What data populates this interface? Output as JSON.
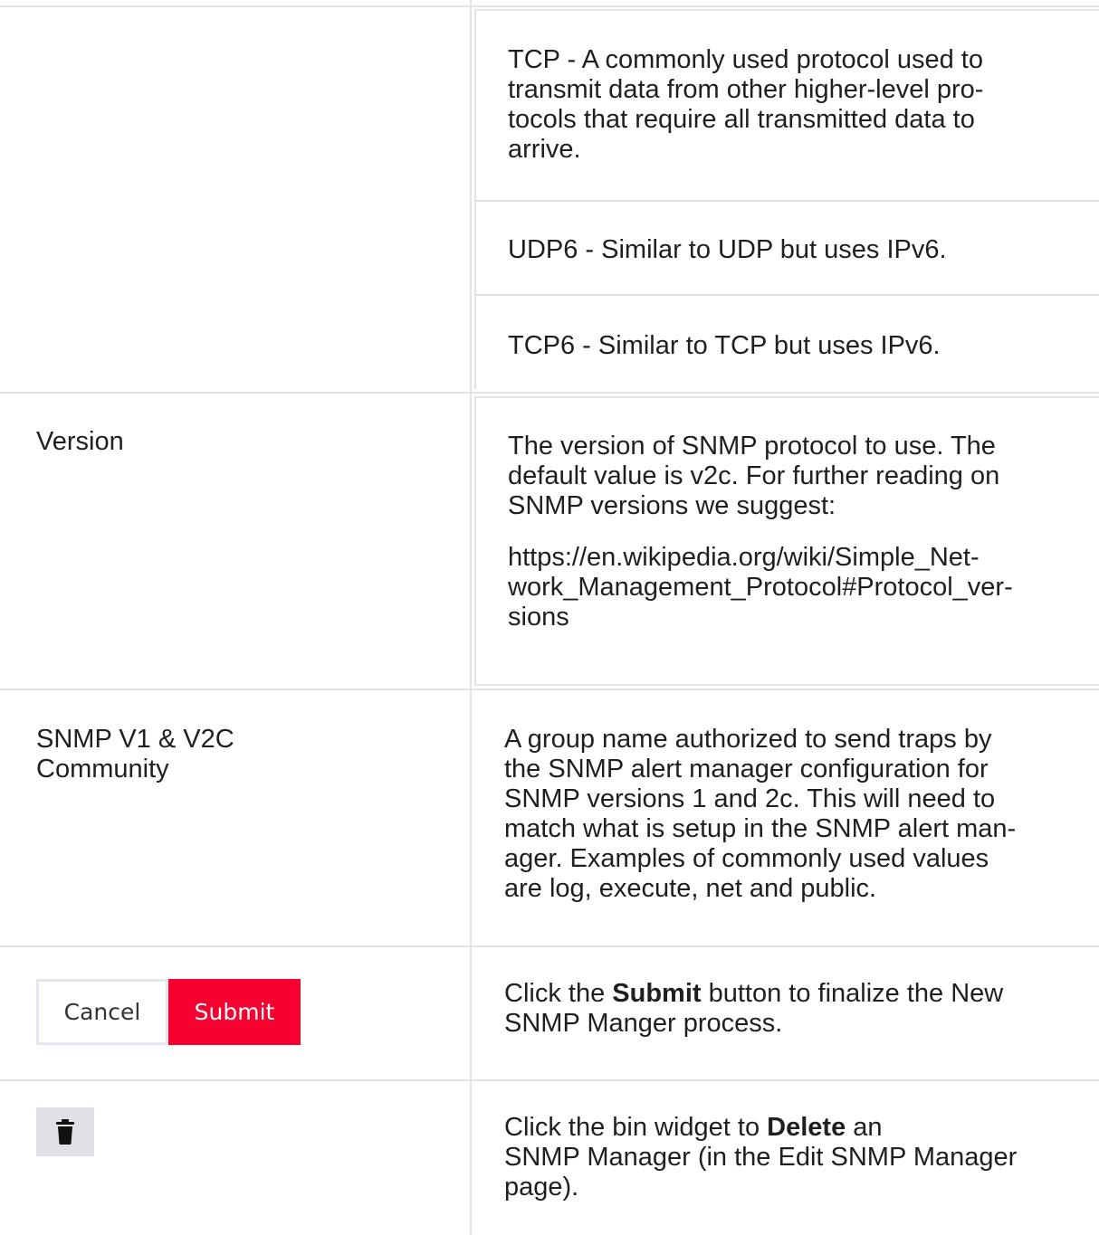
{
  "rows": {
    "transport": {
      "tcp": "TCP - A commonly used protocol used to transmit data from other higher-level pro- tocols that require all transmitted data to arrive.",
      "tcp_lines": [
        "TCP - A commonly used protocol used to",
        "transmit data from other higher-level pro-",
        "tocols that require all transmitted data to",
        "arrive."
      ],
      "udp6": "UDP6 - Similar to UDP but uses IPv6.",
      "tcp6": "TCP6 - Similar to TCP but uses IPv6."
    },
    "version": {
      "label": "Version",
      "desc_lines": [
        "The version of SNMP protocol to use. The",
        "default value is v2c. For further reading on",
        "SNMP versions we suggest:"
      ],
      "link_lines": [
        "https://en.wikipedia.org/wiki/Simple_Net-",
        "work_Management_Protocol#Protocol_ver-",
        "sions"
      ]
    },
    "community": {
      "label_lines": [
        "SNMP V1 & V2C",
        "Community"
      ],
      "desc_lines": [
        "A group name authorized to send traps by",
        "the SNMP alert manager configuration for",
        "SNMP versions 1 and 2c. This will need to",
        "match what is setup in the SNMP alert man-",
        "ager. Examples of commonly used values",
        "are log, execute, net and public."
      ]
    },
    "submit": {
      "cancel_label": "Cancel",
      "submit_label": "Submit",
      "desc_prefix": "Click the ",
      "desc_bold": "Submit",
      "desc_suffix_line1": " button to finalize the New",
      "desc_line2": "SNMP Manger process."
    },
    "delete": {
      "icon": "trash-icon",
      "desc_prefix": "Click the bin widget to ",
      "desc_bold": "Delete",
      "desc_suffix_line1": " an",
      "desc_line2": "SNMP Manager (in the Edit SNMP Manager",
      "desc_line3": "page)."
    }
  },
  "colors": {
    "submit_button": "#f5002f",
    "border": "#e3e3e3",
    "bin_background": "#dfe1e7"
  }
}
